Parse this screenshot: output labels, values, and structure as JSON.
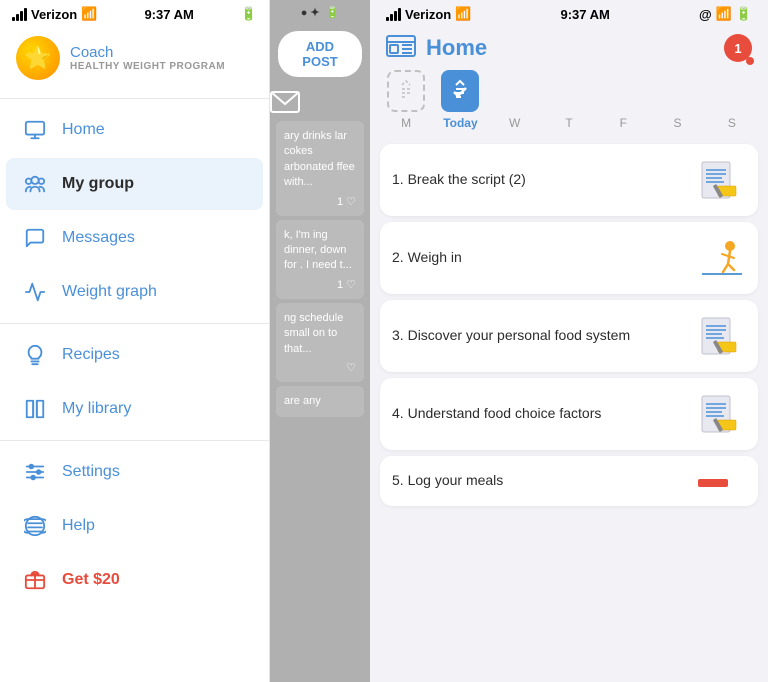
{
  "leftPanel": {
    "statusBar": {
      "carrier": "Verizon",
      "time": "9:37 AM",
      "wifiIcon": "wifi",
      "signalIcon": "signal"
    },
    "coach": {
      "label": "Coach",
      "subtitle": "HEALTHY WEIGHT PROGRAM"
    },
    "navItems": [
      {
        "id": "home",
        "label": "Home",
        "icon": "home"
      },
      {
        "id": "mygroup",
        "label": "My group",
        "icon": "group",
        "active": true
      },
      {
        "id": "messages",
        "label": "Messages",
        "icon": "messages"
      },
      {
        "id": "weightgraph",
        "label": "Weight graph",
        "icon": "graph"
      },
      {
        "id": "recipes",
        "label": "Recipes",
        "icon": "recipes"
      },
      {
        "id": "mylibrary",
        "label": "My library",
        "icon": "library"
      },
      {
        "id": "settings",
        "label": "Settings",
        "icon": "settings"
      },
      {
        "id": "help",
        "label": "Help",
        "icon": "help"
      },
      {
        "id": "get20",
        "label": "Get $20",
        "icon": "gift",
        "special": "red"
      }
    ]
  },
  "middlePanel": {
    "addPostButton": "ADD POST",
    "posts": [
      {
        "text": "ary drinks lar cokes arbonated ffee with...",
        "likes": "1 ♡"
      },
      {
        "text": "k, I'm ing dinner, down for . I need t...",
        "likes": "1 ♡"
      },
      {
        "text": "ng schedule small on to that...",
        "likes": "♡"
      },
      {
        "text": "are any",
        "likes": ""
      }
    ]
  },
  "rightPanel": {
    "statusBar": {
      "carrier": "Verizon",
      "time": "9:37 AM"
    },
    "title": "Home",
    "notificationCount": "1",
    "days": [
      {
        "label": "M",
        "content": "",
        "type": "dashed"
      },
      {
        "label": "Today",
        "content": "",
        "type": "selected"
      },
      {
        "label": "W",
        "content": "",
        "type": "empty"
      },
      {
        "label": "T",
        "content": "",
        "type": "empty"
      },
      {
        "label": "F",
        "content": "",
        "type": "empty"
      },
      {
        "label": "S",
        "content": "",
        "type": "empty"
      },
      {
        "label": "S",
        "content": "",
        "type": "empty"
      }
    ],
    "tasks": [
      {
        "number": "1.",
        "text": "Break the script (2)",
        "illustration": "pencil-paper"
      },
      {
        "number": "2.",
        "text": "Weigh in",
        "illustration": "walking-person"
      },
      {
        "number": "3.",
        "text": "Discover your personal food system",
        "illustration": "pencil-paper"
      },
      {
        "number": "4.",
        "text": "Understand food choice factors",
        "illustration": "pencil-paper"
      },
      {
        "number": "5.",
        "text": "Log your meals",
        "illustration": "bar-red"
      }
    ]
  }
}
